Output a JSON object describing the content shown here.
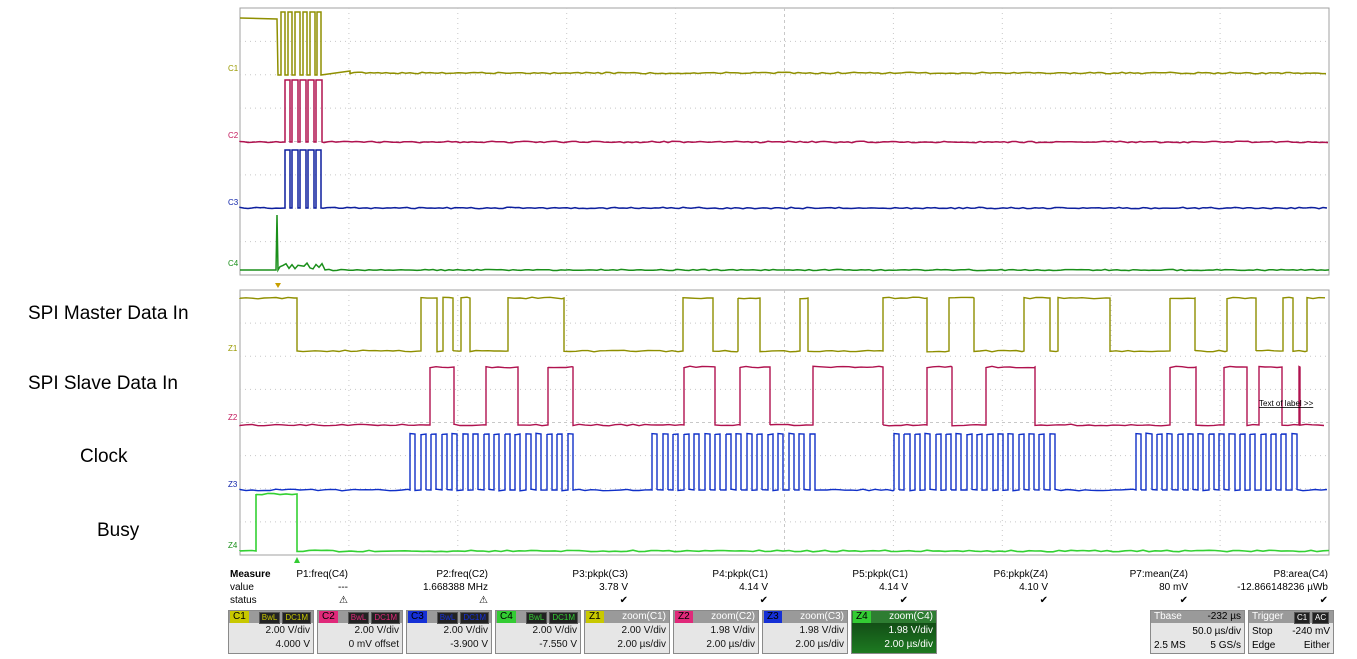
{
  "labels": {
    "master": "SPI Master Data In",
    "slave": "SPI Slave Data In",
    "clock": "Clock",
    "busy": "Busy"
  },
  "colors": {
    "c1": "#9a9a00",
    "c2": "#c2185b",
    "c3": "#0a1fa8",
    "c4": "#1a8f1a",
    "z4": "#33d133",
    "grid": "#c8c8c8",
    "border": "#a0a0a0"
  },
  "traces": {
    "top": {
      "c1": "C1",
      "c2": "C2",
      "c3": "C3",
      "c4": "C4"
    },
    "zoom": {
      "z1": "Z1",
      "z2": "Z2",
      "z3": "Z3",
      "z4": "Z4",
      "text_of_label": "Text of label >>"
    }
  },
  "measure": {
    "title": "Measure",
    "value_label": "value",
    "status_label": "status",
    "params": [
      {
        "name": "P1:freq(C4)",
        "value": "---",
        "status": "warning-icon"
      },
      {
        "name": "P2:freq(C2)",
        "value": "1.668388 MHz",
        "status": "warning-icon"
      },
      {
        "name": "P3:pkpk(C3)",
        "value": "3.78 V",
        "status": "check-icon"
      },
      {
        "name": "P4:pkpk(C1)",
        "value": "4.14 V",
        "status": "check-icon"
      },
      {
        "name": "P5:pkpk(C1)",
        "value": "4.14 V",
        "status": "check-icon"
      },
      {
        "name": "P6:pkpk(Z4)",
        "value": "4.10 V",
        "status": "check-icon"
      },
      {
        "name": "P7:mean(Z4)",
        "value": "80 mV",
        "status": "check-icon"
      },
      {
        "name": "P8:area(C4)",
        "value": "-12.866148236 µWb",
        "status": "check-icon"
      }
    ]
  },
  "channels": [
    {
      "tag": "C1",
      "color": "#c8c800",
      "chips": [
        "BwL",
        "DC1M"
      ],
      "l1": "2.00 V/div",
      "l2": "4.000 V"
    },
    {
      "tag": "C2",
      "color": "#e0297a",
      "chips": [
        "BwL",
        "DC1M"
      ],
      "l1": "2.00 V/div",
      "l2": "0 mV offset"
    },
    {
      "tag": "C3",
      "color": "#1530d6",
      "chips": [
        "BwL",
        "DC1M"
      ],
      "l1": "2.00 V/div",
      "l2": "-3.900 V"
    },
    {
      "tag": "C4",
      "color": "#33cc33",
      "chips": [
        "BwL",
        "DC1M"
      ],
      "l1": "2.00 V/div",
      "l2": "-7.550 V"
    }
  ],
  "zooms": [
    {
      "tag": "Z1",
      "color": "#c8c800",
      "hdr": "zoom(C1)",
      "l1": "2.00 V/div",
      "l2": "2.00 µs/div"
    },
    {
      "tag": "Z2",
      "color": "#e0297a",
      "hdr": "zoom(C2)",
      "l1": "1.98 V/div",
      "l2": "2.00 µs/div"
    },
    {
      "tag": "Z3",
      "color": "#1530d6",
      "hdr": "zoom(C3)",
      "l1": "1.98 V/div",
      "l2": "2.00 µs/div"
    },
    {
      "tag": "Z4",
      "color": "#33cc33",
      "hdr": "zoom(C4)",
      "l1": "1.98 V/div",
      "l2": "2.00 µs/div"
    }
  ],
  "timebase": {
    "title": "Tbase",
    "delay": "-232 µs",
    "div": "50.0 µs/div",
    "samples": "2.5 MS",
    "rate": "5 GS/s"
  },
  "trigger": {
    "title": "Trigger",
    "chips": [
      "C1",
      "AC"
    ],
    "mode": "Stop",
    "level": "-240 mV",
    "type": "Edge",
    "slope": "Either"
  }
}
